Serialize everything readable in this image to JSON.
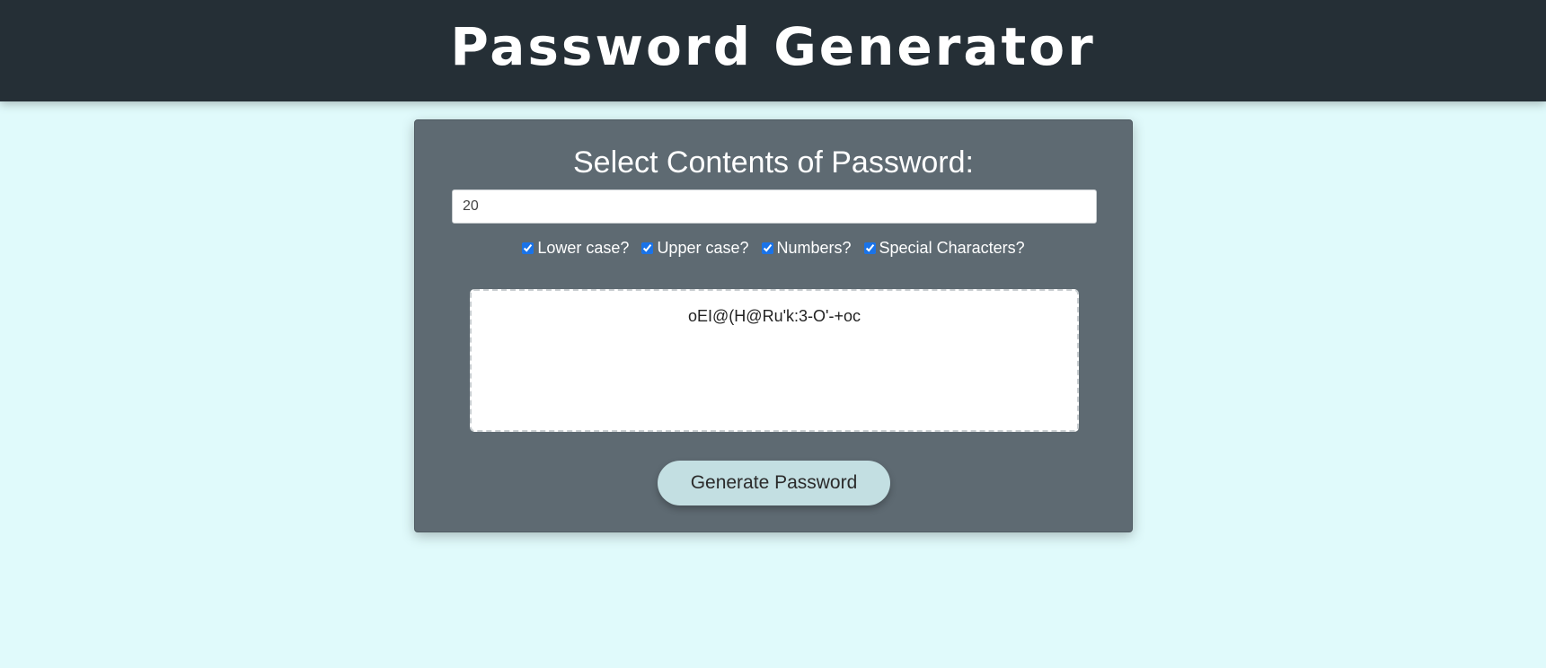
{
  "header": {
    "title": "Password Generator"
  },
  "card": {
    "title": "Select Contents of Password:",
    "length_value": "20",
    "options": [
      {
        "label": "Lower case?",
        "checked": true
      },
      {
        "label": "Upper case?",
        "checked": true
      },
      {
        "label": "Numbers?",
        "checked": true
      },
      {
        "label": "Special Characters?",
        "checked": true
      }
    ],
    "password": "oEI@(H@Ru'k:3-O'-+oc",
    "generate_label": "Generate Password"
  },
  "colors": {
    "header_bg": "#252f36",
    "page_bg": "#e0fafb",
    "card_bg": "#5e6a72",
    "button_bg": "#c3dfe2",
    "checkbox_accent": "#1a73e8"
  }
}
